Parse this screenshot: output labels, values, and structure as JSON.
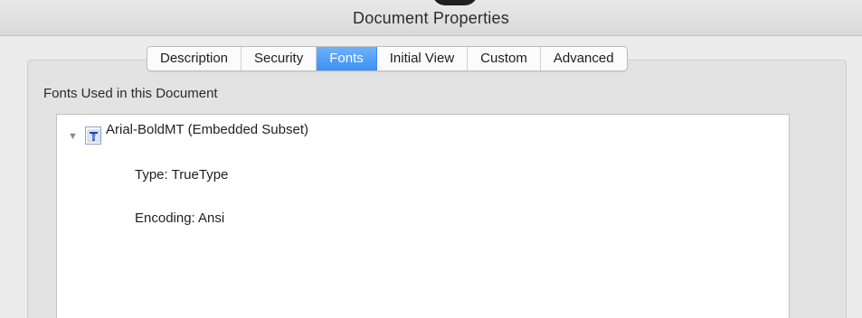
{
  "window": {
    "title": "Document Properties"
  },
  "tabs": [
    {
      "label": "Description",
      "active": false
    },
    {
      "label": "Security",
      "active": false
    },
    {
      "label": "Fonts",
      "active": true
    },
    {
      "label": "Initial View",
      "active": false
    },
    {
      "label": "Custom",
      "active": false
    },
    {
      "label": "Advanced",
      "active": false
    }
  ],
  "fonts_section": {
    "label": "Fonts Used in this Document",
    "fonts": [
      {
        "name": "Arial-BoldMT (Embedded Subset)",
        "icon": "truetype-font-icon",
        "expanded": true,
        "type": "Type: TrueType",
        "encoding": "Encoding: Ansi"
      }
    ]
  },
  "colors": {
    "active_tab": "#3c8ef5",
    "window_bg": "#ececec",
    "list_bg": "#ffffff"
  }
}
